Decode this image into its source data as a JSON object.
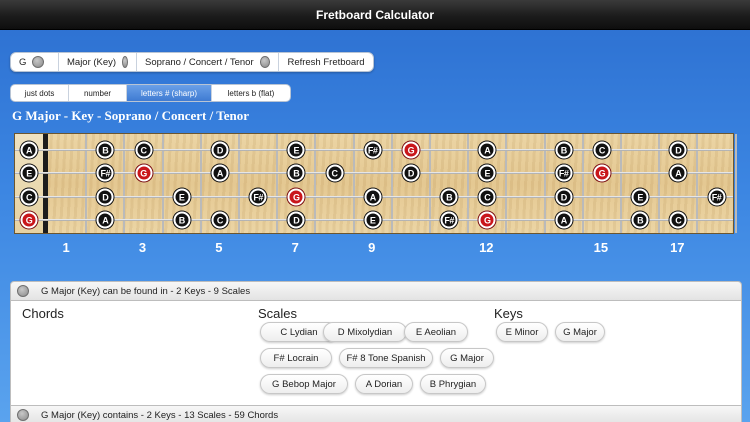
{
  "app": {
    "title": "Fretboard Calculator"
  },
  "toolbar": [
    {
      "label": "G"
    },
    {
      "label": "Major (Key)"
    },
    {
      "label": "Soprano / Concert / Tenor"
    },
    {
      "label": "Refresh Fretboard"
    }
  ],
  "view_tabs": [
    {
      "label": "just dots",
      "active": false
    },
    {
      "label": "number",
      "active": false
    },
    {
      "label": "letters # (sharp)",
      "active": true
    },
    {
      "label": "letters b (flat)",
      "active": false
    }
  ],
  "heading": "G Major - Key - Soprano / Concert / Tenor",
  "fretboard": {
    "strings": [
      {
        "open": "A",
        "root": false,
        "notes": [
          {
            "fret": 2,
            "label": "B"
          },
          {
            "fret": 3,
            "label": "C"
          },
          {
            "fret": 5,
            "label": "D"
          },
          {
            "fret": 7,
            "label": "E"
          },
          {
            "fret": 9,
            "label": "F#"
          },
          {
            "fret": 10,
            "label": "G",
            "root": true
          },
          {
            "fret": 12,
            "label": "A"
          },
          {
            "fret": 14,
            "label": "B"
          },
          {
            "fret": 15,
            "label": "C"
          },
          {
            "fret": 17,
            "label": "D"
          }
        ]
      },
      {
        "open": "E",
        "root": false,
        "notes": [
          {
            "fret": 2,
            "label": "F#"
          },
          {
            "fret": 3,
            "label": "G",
            "root": true
          },
          {
            "fret": 5,
            "label": "A"
          },
          {
            "fret": 7,
            "label": "B"
          },
          {
            "fret": 8,
            "label": "C"
          },
          {
            "fret": 10,
            "label": "D"
          },
          {
            "fret": 12,
            "label": "E"
          },
          {
            "fret": 14,
            "label": "F#"
          },
          {
            "fret": 15,
            "label": "G",
            "root": true
          },
          {
            "fret": 17,
            "label": "A"
          }
        ]
      },
      {
        "open": "C",
        "root": false,
        "notes": [
          {
            "fret": 2,
            "label": "D"
          },
          {
            "fret": 4,
            "label": "E"
          },
          {
            "fret": 6,
            "label": "F#"
          },
          {
            "fret": 7,
            "label": "G",
            "root": true
          },
          {
            "fret": 9,
            "label": "A"
          },
          {
            "fret": 11,
            "label": "B"
          },
          {
            "fret": 12,
            "label": "C"
          },
          {
            "fret": 14,
            "label": "D"
          },
          {
            "fret": 16,
            "label": "E"
          },
          {
            "fret": 18,
            "label": "F#"
          }
        ]
      },
      {
        "open": "G",
        "root": true,
        "notes": [
          {
            "fret": 2,
            "label": "A"
          },
          {
            "fret": 4,
            "label": "B"
          },
          {
            "fret": 5,
            "label": "C"
          },
          {
            "fret": 7,
            "label": "D"
          },
          {
            "fret": 9,
            "label": "E"
          },
          {
            "fret": 11,
            "label": "F#"
          },
          {
            "fret": 12,
            "label": "G",
            "root": true
          },
          {
            "fret": 14,
            "label": "A"
          },
          {
            "fret": 16,
            "label": "B"
          },
          {
            "fret": 17,
            "label": "C"
          }
        ]
      }
    ],
    "fret_markers": [
      "1",
      "3",
      "5",
      "7",
      "9",
      "12",
      "15",
      "17"
    ],
    "root_color": "#c9161b"
  },
  "panel1": {
    "title": "G Major (Key) can be found in - 2 Keys - 9 Scales",
    "chords_title": "Chords",
    "scales_title": "Scales",
    "keys_title": "Keys",
    "scales": [
      "C Lydian",
      "D Mixolydian",
      "E Aeolian",
      "F# Locrain",
      "F# 8 Tone Spanish",
      "G Major",
      "G Bebop Major",
      "A Dorian",
      "B Phrygian"
    ],
    "keys": [
      "E Minor",
      "G Major"
    ]
  },
  "panel2": {
    "title": "G Major (Key) contains - 2 Keys - 13 Scales - 59 Chords"
  }
}
